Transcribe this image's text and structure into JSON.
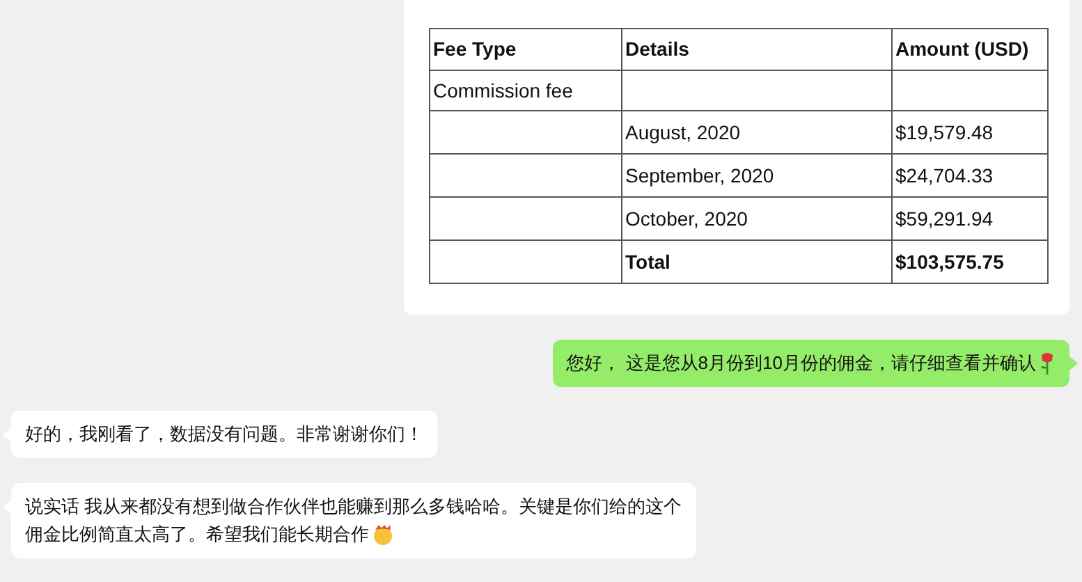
{
  "image_card": {
    "table": {
      "columns": [
        "Fee Type",
        "Details",
        "Amount (USD)"
      ],
      "rows": [
        {
          "cells": [
            "Commission fee",
            "",
            ""
          ],
          "bold": false
        },
        {
          "cells": [
            "",
            "August, 2020",
            "$19,579.48"
          ],
          "bold": false
        },
        {
          "cells": [
            "",
            "September, 2020",
            "$24,704.33"
          ],
          "bold": false
        },
        {
          "cells": [
            "",
            "October, 2020",
            "$59,291.94"
          ],
          "bold": false
        },
        {
          "cells": [
            "",
            "Total",
            "$103,575.75"
          ],
          "bold": true
        }
      ]
    }
  },
  "messages": [
    {
      "outgoing": true,
      "lines": [
        "您好， 这是您从8月份到10月份的佣金，请仔细查看并确认"
      ],
      "emoji": true
    },
    {
      "outgoing": false,
      "lines": [
        "好的，我刚看了，数据没有问题。非常谢谢你们！"
      ],
      "emoji": false
    },
    {
      "outgoing": false,
      "lines": [
        "说实话 我从来都没有想到做合作伙伴也能赚到那么多钱哈哈。关键是你们给的这个",
        "佣金比例简直太高了。希望我们能长期合作"
      ],
      "emoji": true
    }
  ]
}
